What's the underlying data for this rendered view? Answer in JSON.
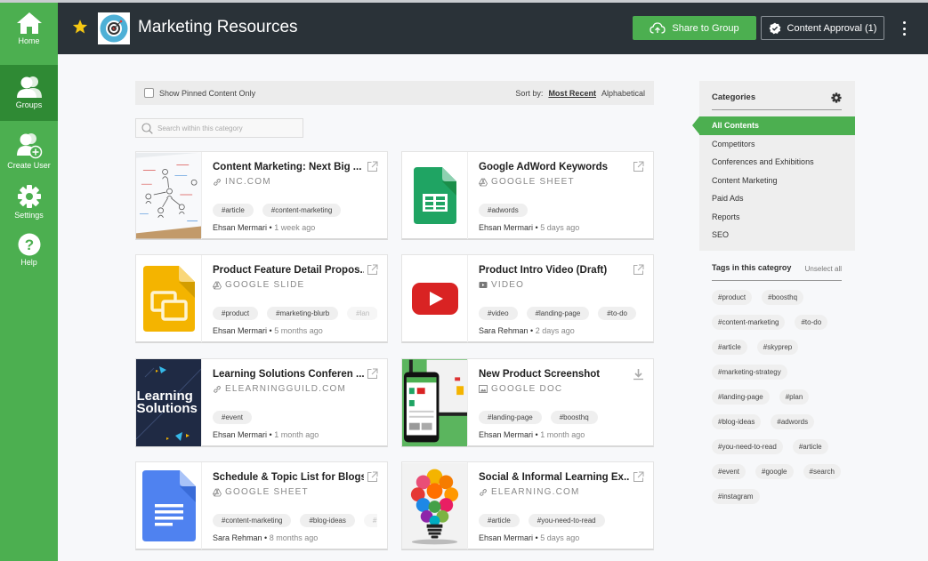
{
  "nav": {
    "items": [
      {
        "label": "Home",
        "icon": "home-icon"
      },
      {
        "label": "Groups",
        "icon": "groups-icon",
        "active": true
      },
      {
        "label": "Create User",
        "icon": "add-user-icon"
      },
      {
        "label": "Settings",
        "icon": "gear-icon"
      },
      {
        "label": "Help",
        "icon": "help-icon"
      }
    ]
  },
  "header": {
    "title": "Marketing Resources",
    "share_label": "Share to Group",
    "approval_label": "Content Approval (1)"
  },
  "filter": {
    "pinned_label": "Show Pinned Content Only",
    "sort_label": "Sort by:",
    "sort_options": [
      "Most Recent",
      "Alphabetical"
    ],
    "sort_selected": "Most Recent",
    "search_placeholder": "Search within this category"
  },
  "cards": [
    {
      "title": "Content Marketing: Next Big ...",
      "source_icon": "link-icon",
      "source": "INC.COM",
      "tags": [
        "#article",
        "#content-marketing"
      ],
      "author": "Ehsan Mermari",
      "time": "1 week ago",
      "action_icon": "external-link-icon",
      "thumb": "whiteboard"
    },
    {
      "title": "Google AdWord Keywords",
      "source_icon": "drive-icon",
      "source": "GOOGLE SHEET",
      "tags": [
        "#adwords"
      ],
      "author": "Ehsan Mermari",
      "time": "5 days ago",
      "action_icon": "external-link-icon",
      "thumb": "sheet"
    },
    {
      "title": "Product Feature Detail Propos...",
      "source_icon": "drive-icon",
      "source": "GOOGLE SLIDE",
      "tags": [
        "#product",
        "#marketing-blurb",
        "#lan"
      ],
      "author": "Ehsan Mermari",
      "time": "5 months ago",
      "action_icon": "external-link-icon",
      "thumb": "slide"
    },
    {
      "title": "Product Intro Video (Draft)",
      "source_icon": "video-icon",
      "source": "VIDEO",
      "tags": [
        "#video",
        "#landing-page",
        "#to-do"
      ],
      "author": "Sara Rehman",
      "time": "2 days ago",
      "action_icon": "external-link-icon",
      "thumb": "youtube"
    },
    {
      "title": "Learning Solutions Conferen ...",
      "source_icon": "link-icon",
      "source": "ELEARNINGGUILD.COM",
      "tags": [
        "#event"
      ],
      "author": "Ehsan Mermari",
      "time": "1 month ago",
      "action_icon": "external-link-icon",
      "thumb": "learning",
      "thumb_text": [
        "Learning",
        "Solutions"
      ]
    },
    {
      "title": "New Product Screenshot",
      "source_icon": "image-icon",
      "source": "GOOGLE DOC",
      "tags": [
        "#landing-page",
        "#boosthq"
      ],
      "author": "Ehsan Mermari",
      "time": "1 month ago",
      "action_icon": "download-icon",
      "thumb": "phone"
    },
    {
      "title": "Schedule & Topic List for Blogs",
      "source_icon": "drive-icon",
      "source": "GOOGLE SHEET",
      "tags": [
        "#content-marketing",
        "#blog-ideas",
        "#"
      ],
      "author": "Sara Rehman",
      "time": "8 months ago",
      "action_icon": "external-link-icon",
      "thumb": "doc"
    },
    {
      "title": "Social & Informal Learning Ex...",
      "source_icon": "link-icon",
      "source": "ELEARNING.COM",
      "tags": [
        "#article",
        "#you-need-to-read"
      ],
      "author": "Ehsan Mermari",
      "time": "5 days ago",
      "action_icon": "external-link-icon",
      "thumb": "bulb"
    }
  ],
  "categories": {
    "heading": "Categories",
    "items": [
      "All Contents",
      "Competitors",
      "Conferences and Exhibitions",
      "Content Marketing",
      "Paid Ads",
      "Reports",
      "SEO"
    ],
    "selected": "All Contents"
  },
  "tags_panel": {
    "heading": "Tags in this categroy",
    "unselect_label": "Unselect all",
    "tags": [
      "#product",
      "#boosthq",
      "#content-marketing",
      "#to-do",
      "#article",
      "#skyprep",
      "#marketing-strategy",
      "#landing-page",
      "#plan",
      "#blog-ideas",
      "#adwords",
      "#you-need-to-read",
      "#article",
      "#event",
      "#google",
      "#search",
      "#instagram"
    ]
  },
  "colors": {
    "accent": "#4caf50",
    "header_bg": "#2a3238",
    "nav_active": "#2f8a34"
  }
}
